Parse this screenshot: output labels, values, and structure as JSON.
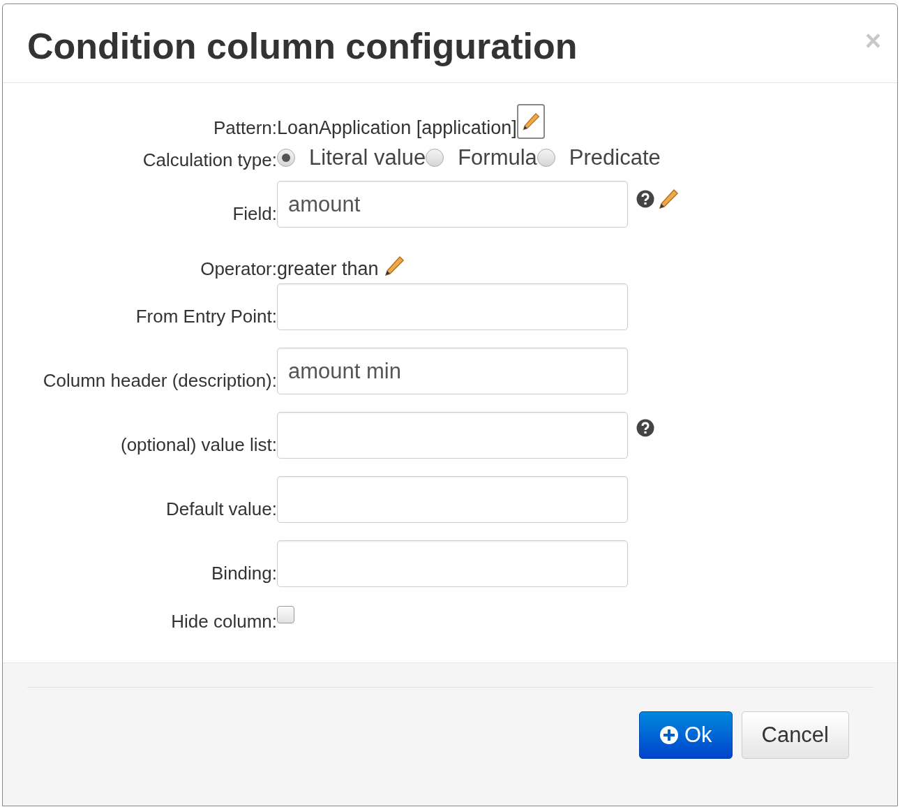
{
  "dialog": {
    "title": "Condition column configuration",
    "close": "×"
  },
  "rows": [
    {
      "kind": "text",
      "label": "Pattern:",
      "value": "LoanApplication [application]",
      "edit": {
        "kind": "button"
      }
    },
    {
      "kind": "radio",
      "label": "Calculation type:",
      "options": [
        {
          "label": "Literal value",
          "selected": true
        },
        {
          "label": "Formula",
          "selected": false
        },
        {
          "label": "Predicate",
          "selected": false
        }
      ]
    },
    {
      "kind": "input",
      "label": "Field:",
      "value": "amount",
      "help": true,
      "edit": {
        "kind": "icon"
      }
    },
    {
      "kind": "text",
      "label": "Operator:",
      "value": "greater than",
      "edit": {
        "kind": "icon"
      }
    },
    {
      "kind": "input",
      "label": "From Entry Point:"
    },
    {
      "kind": "input",
      "label": "Column header (description):",
      "value": "amount min"
    },
    {
      "kind": "input",
      "label": "(optional) value list:",
      "help": true
    },
    {
      "kind": "input",
      "label": "Default value:"
    },
    {
      "kind": "input",
      "label": "Binding:"
    },
    {
      "kind": "checkbox",
      "label": "Hide column:",
      "checked": false
    }
  ],
  "buttons": [
    {
      "label": "Ok",
      "kind": "primary"
    },
    {
      "label": "Cancel",
      "kind": "default"
    }
  ]
}
